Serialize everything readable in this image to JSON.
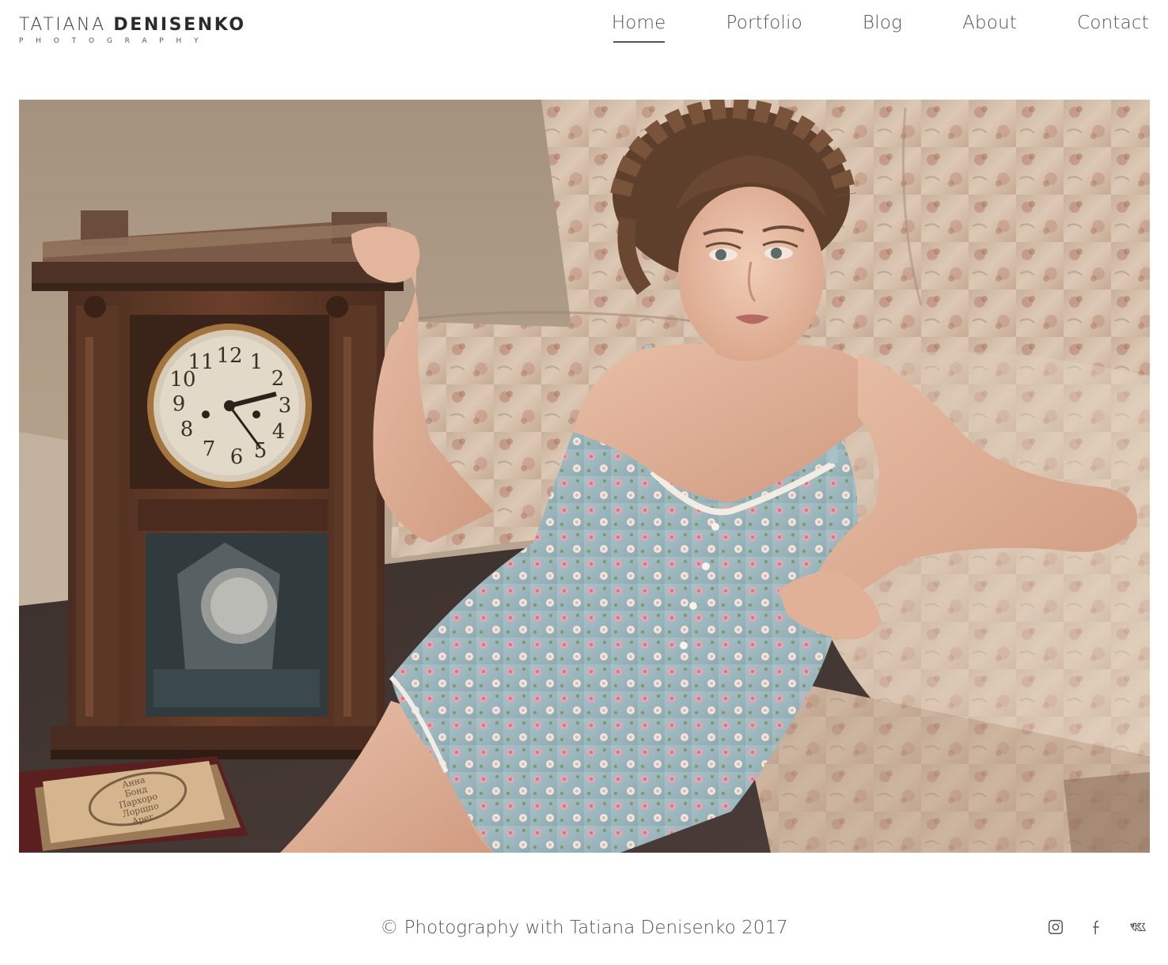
{
  "brand": {
    "name_light": "TATIANA",
    "name_bold": "DENISENKO",
    "tagline": "PHOTOGRAPHY"
  },
  "nav": {
    "items": [
      {
        "label": "Home",
        "active": true
      },
      {
        "label": "Portfolio",
        "active": false
      },
      {
        "label": "Blog",
        "active": false
      },
      {
        "label": "About",
        "active": false
      },
      {
        "label": "Contact",
        "active": false
      }
    ]
  },
  "hero": {
    "clock_numerals": [
      "12",
      "1",
      "2",
      "3",
      "4",
      "5",
      "6",
      "7",
      "8",
      "9",
      "10",
      "11"
    ],
    "book_lines": [
      "Анна",
      "Бонд",
      "Пархоро",
      "Лорщпо",
      "Арег"
    ]
  },
  "footer": {
    "copyright": "© Photography with Tatiana Denisenko 2017",
    "social": [
      {
        "icon": "instagram-icon"
      },
      {
        "icon": "facebook-icon"
      },
      {
        "icon": "vk-icon"
      }
    ]
  },
  "colors": {
    "text": "#555555",
    "logo": "#2f2f2f",
    "background": "#ffffff"
  }
}
